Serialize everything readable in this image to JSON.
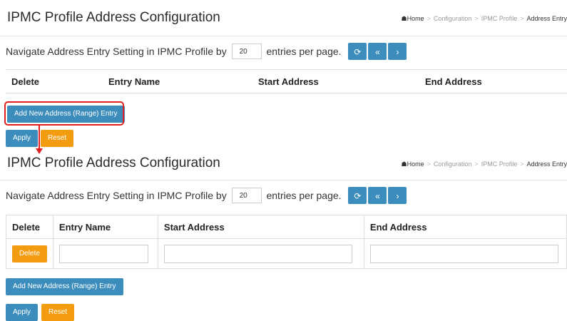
{
  "title": "IPMC Profile Address Configuration",
  "breadcrumb": {
    "home": "Home",
    "items": [
      "Configuration",
      "IPMC Profile",
      "Address Entry"
    ]
  },
  "nav": {
    "prefix": "Navigate Address Entry Setting in IPMC Profile by",
    "entries": "20",
    "suffix": "entries per page."
  },
  "icons": {
    "refresh": "refresh-icon",
    "first": "first-page-icon",
    "next": "next-page-icon",
    "home": "home-icon"
  },
  "table": {
    "headers": {
      "delete": "Delete",
      "entry_name": "Entry Name",
      "start_address": "Start Address",
      "end_address": "End Address"
    }
  },
  "row": {
    "delete_label": "Delete",
    "entry_name": "",
    "start_address": "",
    "end_address": ""
  },
  "buttons": {
    "add_new": "Add New Address (Range) Entry",
    "apply": "Apply",
    "reset": "Reset"
  },
  "colors": {
    "primary": "#3c8dbc",
    "warning": "#f39c12",
    "highlight": "#e02020"
  }
}
